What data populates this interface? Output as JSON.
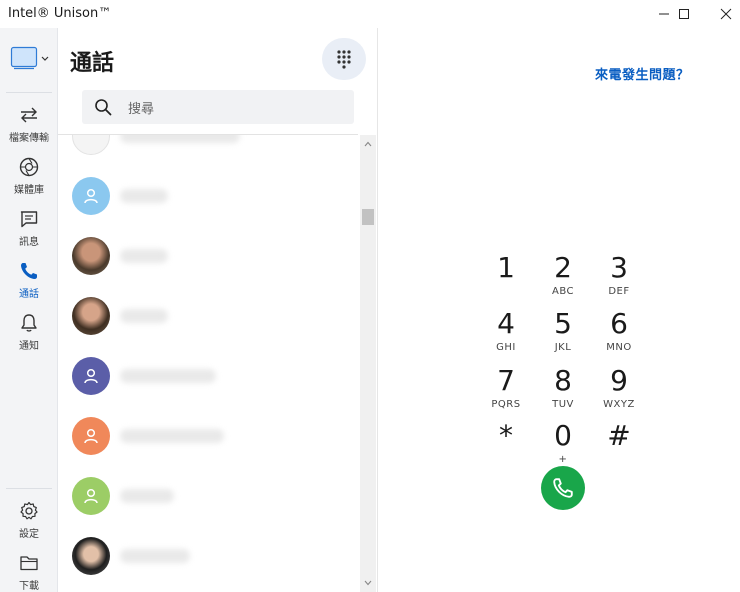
{
  "window": {
    "title": "Intel® Unison™"
  },
  "rail": {
    "items": [
      {
        "label": "檔案傳輸",
        "icon": "transfer-icon"
      },
      {
        "label": "媒體庫",
        "icon": "aperture-icon"
      },
      {
        "label": "訊息",
        "icon": "message-icon"
      },
      {
        "label": "通話",
        "icon": "phone-icon",
        "active": true
      },
      {
        "label": "通知",
        "icon": "bell-icon"
      }
    ],
    "bottom_items": [
      {
        "label": "設定",
        "icon": "gear-icon"
      },
      {
        "label": "下載",
        "icon": "folder-icon"
      }
    ]
  },
  "calls": {
    "title": "通話",
    "search_placeholder": "搜尋",
    "contacts": [
      {
        "avatar": "photo-partial"
      },
      {
        "avatar": "default",
        "color": "#8bc8ef"
      },
      {
        "avatar": "photo"
      },
      {
        "avatar": "photo"
      },
      {
        "avatar": "default",
        "color": "#5b5ea8"
      },
      {
        "avatar": "default",
        "color": "#f0885a"
      },
      {
        "avatar": "default",
        "color": "#9ccd66"
      },
      {
        "avatar": "photo"
      }
    ]
  },
  "dialer": {
    "help_link": "來電發生問題？",
    "keys": [
      {
        "digit": "1",
        "letters": ""
      },
      {
        "digit": "2",
        "letters": "ABC"
      },
      {
        "digit": "3",
        "letters": "DEF"
      },
      {
        "digit": "4",
        "letters": "GHI"
      },
      {
        "digit": "5",
        "letters": "JKL"
      },
      {
        "digit": "6",
        "letters": "MNO"
      },
      {
        "digit": "7",
        "letters": "PQRS"
      },
      {
        "digit": "8",
        "letters": "TUV"
      },
      {
        "digit": "9",
        "letters": "WXYZ"
      },
      {
        "digit": "*",
        "letters": ""
      },
      {
        "digit": "0",
        "letters": "+"
      },
      {
        "digit": "#",
        "letters": ""
      }
    ]
  },
  "colors": {
    "accent": "#0a5ec2",
    "call_green": "#19a64a"
  }
}
